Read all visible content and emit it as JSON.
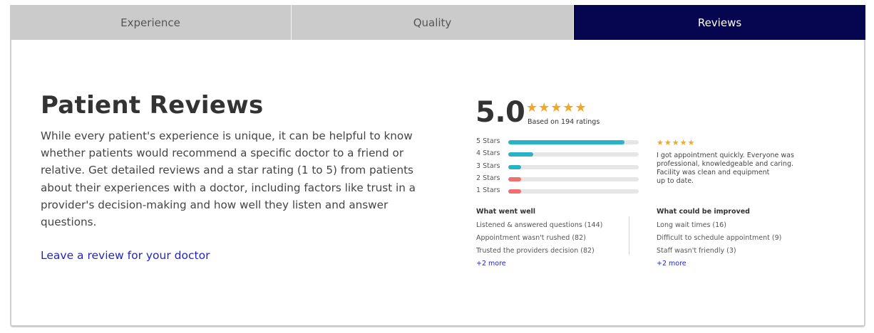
{
  "tabs": [
    {
      "label": "Experience"
    },
    {
      "label": "Quality"
    },
    {
      "label": "Reviews"
    }
  ],
  "active_tab": "Reviews",
  "intro": {
    "title": "Patient Reviews",
    "description": "While every patient's experience is unique, it can be helpful to know whether patients would recommend a specific doctor to a friend or relative. Get detailed reviews and a star rating (1 to 5) from patients about their experiences with a doctor, including factors like trust in a provider's decision-making and how well they listen and answer questions.",
    "link": "Leave a review for your doctor"
  },
  "rating": {
    "score": "5.0",
    "stars": "★★★★★",
    "based_on": "Based on 194 ratings",
    "distribution": [
      {
        "label": "5 Stars",
        "fraction": 0.89,
        "color": "#2ab3c4"
      },
      {
        "label": "4 Stars",
        "fraction": 0.19,
        "color": "#2ab3c4"
      },
      {
        "label": "3 Stars",
        "fraction": 0.1,
        "color": "#2ab3c4"
      },
      {
        "label": "2 Stars",
        "fraction": 0.1,
        "color": "#f07070"
      },
      {
        "label": "1 Stars",
        "fraction": 0.1,
        "color": "#f07070"
      }
    ]
  },
  "sample_review": {
    "stars": "★★★★★",
    "lines": [
      "I got appointment quickly. Everyone was",
      "professional, knowledgeable and caring.",
      "Facility was clean and equipment",
      "up to date."
    ]
  },
  "went_well": {
    "title": "What went well",
    "items": [
      "Listened & answered questions (144)",
      "Appointment wasn't rushed (82)",
      "Trusted the providers decision (82)"
    ],
    "more": "+2 more"
  },
  "improve": {
    "title": "What could be improved",
    "items": [
      "Long wait times (16)",
      "Difficult to schedule appointment (9)",
      "Staff wasn't friendly (3)"
    ],
    "more": "+2 more"
  },
  "colors": {
    "active_tab": "#050550",
    "inactive_tab": "#cbcbcb",
    "star": "#f5a623",
    "link": "#2323c8",
    "bar_positive": "#2ab3c4",
    "bar_negative": "#f07070"
  }
}
